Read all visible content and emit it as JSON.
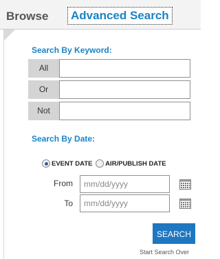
{
  "tabs": {
    "browse": "Browse",
    "advanced": "Advanced Search"
  },
  "keyword": {
    "title": "Search By Keyword:",
    "rows": [
      {
        "label": "All",
        "value": ""
      },
      {
        "label": "Or",
        "value": ""
      },
      {
        "label": "Not",
        "value": ""
      }
    ]
  },
  "date": {
    "title": "Search By Date:",
    "options": [
      {
        "label": "EVENT DATE",
        "checked": true
      },
      {
        "label": "AIR/PUBLISH DATE",
        "checked": false
      }
    ],
    "from_label": "From",
    "to_label": "To",
    "placeholder": "mm/dd/yyyy"
  },
  "actions": {
    "search": "SEARCH",
    "start_over": "Start Search Over"
  },
  "colors": {
    "accent": "#1a83c6",
    "button": "#1f77c0",
    "label_bg": "#d4d4d4"
  },
  "icons": [
    "calendar-icon"
  ]
}
